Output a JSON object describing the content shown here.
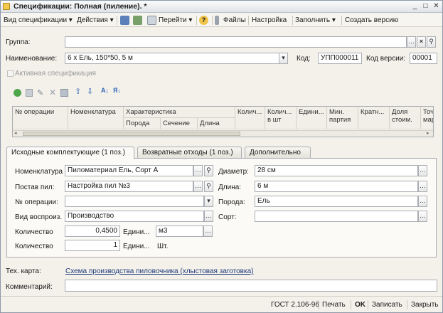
{
  "window": {
    "title": "Спецификации: Полная (пиление). *"
  },
  "menu": {
    "view_spec": "Вид спецификации ▾",
    "actions": "Действия ▾",
    "goto": "Перейти ▾",
    "help": "?",
    "files": "Файлы",
    "settings": "Настройка",
    "fill": "Заполнить ▾",
    "create_version": "Создать версию"
  },
  "header": {
    "group_label": "Группа:",
    "group_value": "",
    "name_label": "Наименование:",
    "name_value": "6 х Ель, 150*50, 5 м",
    "code_label": "Код:",
    "code_value": "УПП000011",
    "version_code_label": "Код версии:",
    "version_code_value": "00001",
    "active_spec": "Активная спецификация"
  },
  "table": {
    "columns": [
      "№ операции",
      "Номенклатура",
      "Характеристика",
      "Колич...",
      "Колич...\nв шт",
      "Едини...",
      "Мин.\nпартия",
      "Кратн...",
      "Доля\nстоим.",
      "Точ\nмар"
    ],
    "sub_columns": [
      "Порода",
      "Сечение",
      "Длина"
    ]
  },
  "tabs": [
    "Исходные комплектующие (1 поз.)",
    "Возвратные отходы (1 поз.)",
    "Дополнительно"
  ],
  "detail": {
    "nomenclature_label": "Номенклатура",
    "nomenclature_value": "Пиломатериал Ель, Сорт А",
    "post_label": "Постав пил:",
    "post_value": "Настройка пил №3",
    "op_label": "№ операции:",
    "op_value": "",
    "repro_label": "Вид воспроиз.",
    "repro_value": "Производство",
    "qty_label": "Количество",
    "qty_value": "0,4500",
    "unit_label": "Едини...",
    "unit_value": "м3",
    "qty2_label": "Количество",
    "qty2_value": "1",
    "unit2_label": "Едини...",
    "unit2_value": "Шт.",
    "diameter_label": "Диаметр:",
    "diameter_value": "28 см",
    "length_label": "Длина:",
    "length_value": "6 м",
    "species_label": "Порода:",
    "species_value": "Ель",
    "grade_label": "Сорт:",
    "grade_value": ""
  },
  "footer": {
    "techcard_label": "Тех. карта:",
    "techcard_link": "Схема производства пиловочника (хлыстовая заготовка)",
    "comment_label": "Комментарий:",
    "comment_value": ""
  },
  "status": {
    "gost": "ГОСТ 2.106-96",
    "print": "Печать",
    "ok": "OK",
    "save": "Записать",
    "close": "Закрыть"
  }
}
